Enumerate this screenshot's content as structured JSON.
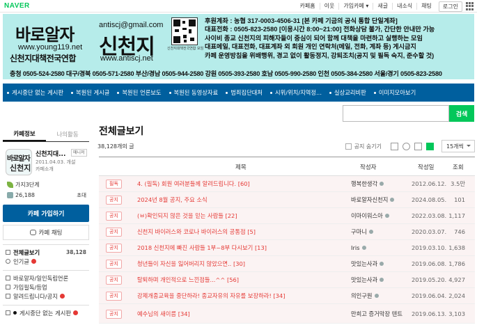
{
  "topbar": {
    "logo": "NAVER",
    "links": [
      "카페홈",
      "이웃",
      "가입카페 ▾",
      "새글",
      "내소식",
      "채팅"
    ],
    "login": "로그인"
  },
  "banner": {
    "title_left": "바로알자",
    "email": "antiscj@gmail.com",
    "title_right": "신천지",
    "url_left": "www.young119.net",
    "union": "신천지대책전국연합",
    "url_right": "www.antiscj.net",
    "qr_label": "신천지대책전국연합 모임",
    "info_lines": [
      "후원계좌 : 농협 317-0003-4506-31  [본 카페 기금의 공식 통합 단일계좌]",
      "대표전화 : 0505-823-2580 [이용시간 8:00~21:00] 전화상담 불가, 간단한 안내만 가능",
      "사이비 종교 신천지의 피해자들이 중심이 되어 함께 대책을 마련하고 실행하는 모임",
      "대표메일, 대표전화, 대표계좌 외 회원 개인 연락처(메일, 전화, 계좌 등) 게시금지",
      "카페 운영방침을 위배행위, 경고 없이 활동정지, 강퇴조치(공지 및 필독 숙지, 준수할 것)"
    ],
    "phones": "충청 0505-524-2580  대구/경북 0505-571-2580  부산/경남 0505-944-2580  강원 0505-393-2580  호남 0505-990-2580  인천 0505-384-2580  서울/경기 0505-823-2580"
  },
  "menu": [
    "게시중단 없는 게시판",
    "복원된 게시글",
    "복원된 언론보도",
    "복원된 동영상자료",
    "범죄집단대처",
    "시위/위치/지역정...",
    "실상교리비판",
    "이미지모아보기"
  ],
  "search": {
    "placeholder": "",
    "button": "검색"
  },
  "sidebar": {
    "tabs": [
      "카페정보",
      "나의활동"
    ],
    "thumb_line1": "바로알자",
    "thumb_line2": "신천지",
    "cafe_name": "신천지대...",
    "manager": "매니저",
    "since": "2011.04.03. 개설",
    "intro": "카페소개",
    "level": "가지3단계",
    "members": "26,188",
    "invite": "초대",
    "join": "카페 가입하기",
    "chat": "카페 채팅",
    "menu": [
      {
        "label": "전체글보기",
        "count": "38,128",
        "bold": true
      },
      {
        "label": "인기글",
        "count": "",
        "new": true
      },
      {
        "label": "바로알자/일인독립언론",
        "count": ""
      },
      {
        "label": "가입필독/등업",
        "count": ""
      },
      {
        "label": "알려드립니다/공지",
        "count": "",
        "new": true
      },
      {
        "label": "게시중단 없는 게시판",
        "count": "",
        "new": true
      }
    ]
  },
  "main": {
    "title": "전체글보기",
    "count": "38,128개의 글",
    "hide_notice": "공지 숨기기",
    "per_page": "15개씩",
    "headers": {
      "subject": "제목",
      "author": "작성자",
      "date": "작성일",
      "views": "조회"
    },
    "rows": [
      {
        "cat": "필독",
        "subject": "4. (필독) 회원 여러분들께 알려드립니다. [60]",
        "author": "행복한생각",
        "date": "2012.06.12.",
        "views": "3.5만"
      },
      {
        "cat": "공지",
        "subject": "2024년 8월 공지, 주요 소식",
        "author": "바로알자신천지",
        "date": "2024.08.05.",
        "views": "101"
      },
      {
        "cat": "공지",
        "subject": "(ㅂ)확인되지 않은 것을 믿는 사람들 [22]",
        "author": "이마이워스아",
        "date": "2022.03.08.",
        "views": "1,117"
      },
      {
        "cat": "공지",
        "subject": "신천지 바이러스와 코로나 바이러스의 공통점 [5]",
        "author": "구마니",
        "date": "2020.03.07.",
        "views": "746"
      },
      {
        "cat": "공지",
        "subject": "2018 신천지에 빠진 사람들 1부~8부 다시보기 [13]",
        "author": "Iris",
        "date": "2019.03.10.",
        "views": "1,638"
      },
      {
        "cat": "공지",
        "subject": "청년들이 자신을 잃어버리지 않았으면.. [30]",
        "author": "맛있는사과",
        "date": "2019.06.08.",
        "views": "1,786"
      },
      {
        "cat": "공지",
        "subject": "탈퇴하며 개인적으로 느낀점들...^^ [56]",
        "author": "맛있는사과",
        "date": "2019.05.20.",
        "views": "4,927"
      },
      {
        "cat": "공지",
        "subject": "강제개종교육을 중단하라! 종교자유의 자유를 보장하라! [34]",
        "author": "의인구원",
        "date": "2019.06.04.",
        "views": "2,024"
      },
      {
        "cat": "공지",
        "subject": "예수님의 새이름 [34]",
        "author": "만희고 증거막장 텐트",
        "date": "2019.06.13.",
        "views": "3,103"
      }
    ]
  }
}
